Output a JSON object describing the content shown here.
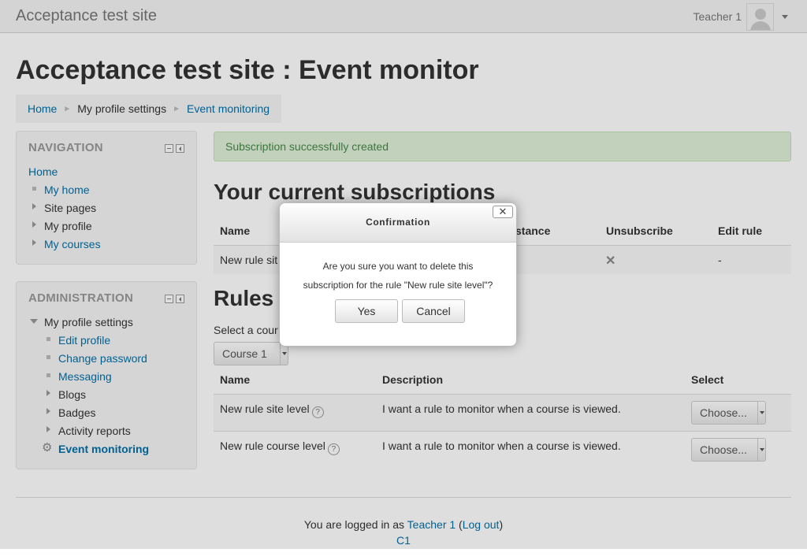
{
  "navbar": {
    "brand": "Acceptance test site",
    "user_name": "Teacher 1"
  },
  "page_title": "Acceptance test site : Event monitor",
  "breadcrumb": {
    "home": "Home",
    "profile_settings": "My profile settings",
    "current": "Event monitoring",
    "separator": "►"
  },
  "navigation": {
    "title": "NAVIGATION",
    "home": "Home",
    "items": [
      "My home",
      "Site pages",
      "My profile",
      "My courses"
    ]
  },
  "administration": {
    "title": "ADMINISTRATION",
    "profile_settings": "My profile settings",
    "items": [
      "Edit profile",
      "Change password",
      "Messaging",
      "Blogs",
      "Badges",
      "Activity reports",
      "Event monitoring"
    ]
  },
  "alert": "Subscription successfully created",
  "subscriptions": {
    "heading": "Your current subscriptions",
    "headers": {
      "name": "Name",
      "instance": "stance",
      "unsubscribe": "Unsubscribe",
      "edit_rule": "Edit rule"
    },
    "row": {
      "name": "New rule sit",
      "edit_rule": "-"
    }
  },
  "rules": {
    "heading": "Rules",
    "select_label": "Select a cour",
    "course_select": "Course 1",
    "headers": {
      "name": "Name",
      "description": "Description",
      "select": "Select"
    },
    "rows": [
      {
        "name": "New rule site level",
        "description": "I want a rule to monitor when a course is viewed.",
        "choose": "Choose..."
      },
      {
        "name": "New rule course level",
        "description": "I want a rule to monitor when a course is viewed.",
        "choose": "Choose..."
      }
    ]
  },
  "footer": {
    "logged_in": "You are logged in as",
    "user": "Teacher 1",
    "logout": "Log out",
    "course": "C1"
  },
  "dialog": {
    "title": "Confirmation",
    "message_line1": "Are you sure you want to delete this",
    "message_line2": "subscription for the rule \"New rule site level\"?",
    "yes": "Yes",
    "cancel": "Cancel",
    "close": "✕"
  }
}
